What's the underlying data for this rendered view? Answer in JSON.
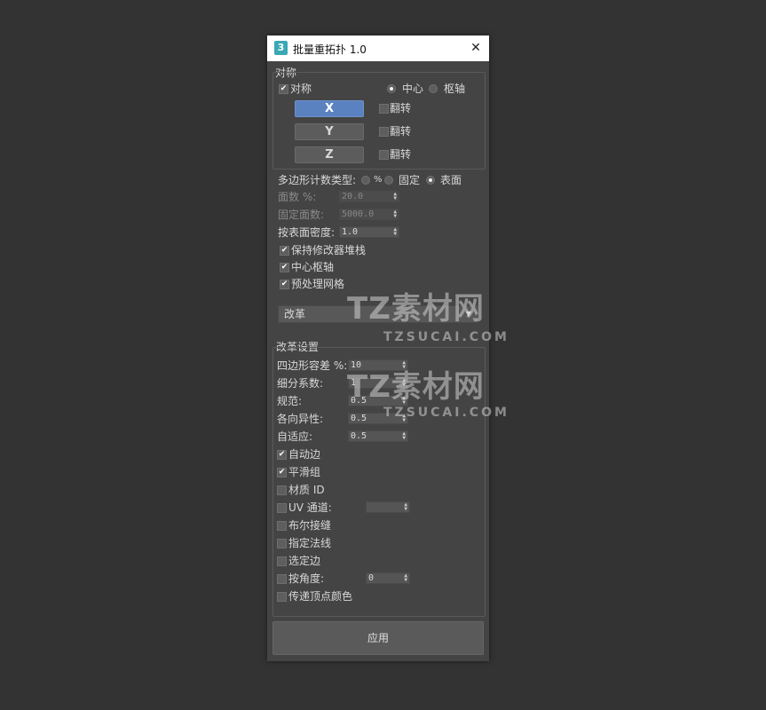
{
  "window": {
    "icon_glyph": "3",
    "title": "批量重拓扑 1.0",
    "close_glyph": "✕"
  },
  "symmetry": {
    "group_label": "对称",
    "enable_label": "对称",
    "enable_checked": true,
    "center_label": "中心",
    "pivot_label": "枢轴",
    "selected_mode": "center",
    "axes": [
      {
        "label": "X",
        "active": true,
        "flip_label": "翻转",
        "flip_checked": false
      },
      {
        "label": "Y",
        "active": false,
        "flip_label": "翻转",
        "flip_checked": false
      },
      {
        "label": "Z",
        "active": false,
        "flip_label": "翻转",
        "flip_checked": false
      }
    ]
  },
  "poly_count": {
    "type_label": "多边形计数类型:",
    "percent_label": "%",
    "fixed_label": "固定",
    "surface_label": "表面",
    "selected": "surface",
    "face_percent_label": "面数 %:",
    "face_percent_value": "20.0",
    "fixed_faces_label": "固定面数:",
    "fixed_faces_value": "5000.0",
    "surface_density_label": "按表面密度:",
    "surface_density_value": "1.0"
  },
  "options": [
    {
      "label": "保持修改器堆栈",
      "checked": true
    },
    {
      "label": "中心枢轴",
      "checked": true
    },
    {
      "label": "预处理网格",
      "checked": true
    }
  ],
  "method": {
    "selected": "改革"
  },
  "reform": {
    "group_label": "改革设置",
    "quad_tolerance_label": "四边形容差 %:",
    "quad_tolerance_value": "10",
    "subdivision_label": "细分系数:",
    "subdivision_value": "1",
    "regularize_label": "规范:",
    "regularize_value": "0.5",
    "anisotropy_label": "各向异性:",
    "anisotropy_value": "0.5",
    "adaptive_label": "自适应:",
    "adaptive_value": "0.5",
    "checks": [
      {
        "label": "自动边",
        "checked": true
      },
      {
        "label": "平滑组",
        "checked": true
      },
      {
        "label": "材质 ID",
        "checked": false
      },
      {
        "label": "UV 通道:",
        "checked": false
      },
      {
        "label": "布尔接缝",
        "checked": false
      },
      {
        "label": "指定法线",
        "checked": false
      },
      {
        "label": "选定边",
        "checked": false
      },
      {
        "label": "按角度:",
        "checked": false
      },
      {
        "label": "传递顶点颜色",
        "checked": false
      }
    ],
    "uv_channel_value": "",
    "angle_value": "0"
  },
  "apply_label": "应用",
  "watermark": {
    "brand": "TZ素材网",
    "domain": "TZSUCAI.COM"
  },
  "colors": {
    "accent": "#5b82c0",
    "panel": "#444444",
    "background": "#333333",
    "titlebar": "#ffffff"
  }
}
